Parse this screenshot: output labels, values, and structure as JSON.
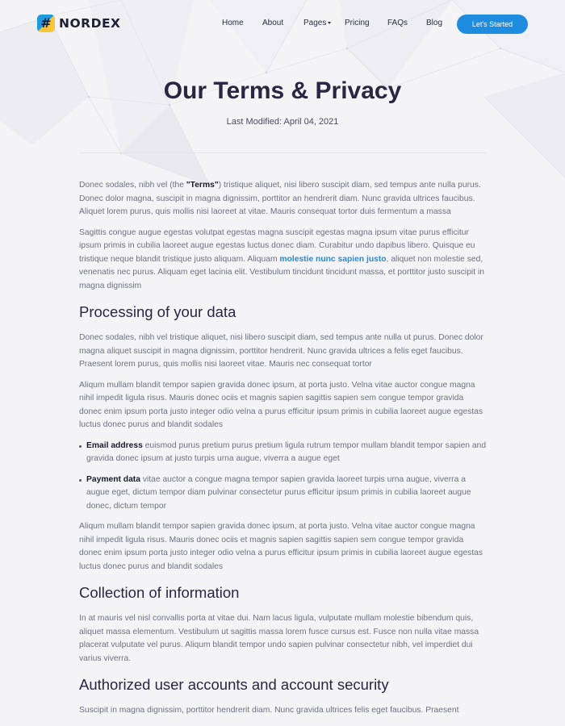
{
  "brand": {
    "logo_glyph": "#",
    "name": "NORDEX",
    "primary": "#1e8de0",
    "accent": "#f7c63b"
  },
  "nav": {
    "items": [
      "Home",
      "About",
      "Pages",
      "Pricing",
      "FAQs",
      "Blog"
    ],
    "cta": "Let's Started"
  },
  "page": {
    "title": "Our Terms & Privacy",
    "modified": "Last Modified: April 04, 2021"
  },
  "intro": {
    "p1_a": "Donec sodales, nibh vel (the ",
    "p1_b": "\"Terms\"",
    "p1_c": ") tristique aliquet, nisi libero suscipit diam, sed tempus ante nulla purus. Donec dolor magna, suscipit in magna dignissim, porttitor an hendrerit diam. Nunc gravida ultrices faucibus. Aliquet lorem purus, quis mollis nisi laoreet at vitae. Mauris consequat tortor duis fermentum a massa",
    "p2_a": "Sagittis congue augue egestas volutpat egestas magna suscipit egestas magna ipsum vitae purus efficitur ipsum primis in cubilia laoreet augue egestas luctus donec diam. Curabitur undo dapibus libero. Quisque eu tristique neque blandit tristique justo aliquam. Aliquam ",
    "p2_link": "molestie nunc sapien justo",
    "p2_c": ", aliquet non molestie sed, venenatis nec purus. Aliquam eget lacinia elit. Vestibulum tincidunt tincidunt massa, et porttitor justo suscipit in magna dignissim"
  },
  "processing": {
    "heading": "Processing of your data",
    "p1": "Donec sodales, nibh vel tristique aliquet, nisi libero suscipit diam, sed tempus ante nulla ut purus. Donec dolor magna aliquet suscipit in magna dignissim, porttitor hendrerit. Nunc gravida ultrices a felis eget faucibus. Praesent lorem purus, quis mollis nisi laoreet vitae. Mauris nec consequat tortor",
    "p2": "Aliqum mullam blandit tempor sapien gravida donec ipsum, at porta justo. Velna vitae auctor congue magna nihil impedit ligula risus. Mauris donec ociis et magnis sapien sagittis sapien sem congue tempor gravida donec enim ipsum porta justo integer odio velna a purus efficitur ipsum primis in cubilia laoreet augue egestas luctus donec purus and blandit sodales",
    "bullet1_label": "Email address",
    "bullet1_text": " euismod purus pretium purus pretium ligula rutrum tempor mullam blandit tempor sapien and gravida donec ipsum at justo turpis urna augue, viverra a augue eget",
    "bullet2_label": "Payment data",
    "bullet2_text": " vitae auctor a congue magna tempor sapien gravida laoreet turpis urna augue, viverra a augue eget, dictum tempor diam pulvinar consectetur purus efficitur ipsum primis in cubilia laoreet augue donec, dictum tempor",
    "p3": "Aliqum mullam blandit tempor sapien gravida donec ipsum, at porta justo. Velna vitae auctor congue magna nihil impedit ligula risus. Mauris donec ociis et magnis sapien sagittis sapien sem congue tempor gravida donec enim ipsum porta justo integer odio velna a purus efficitur ipsum primis in cubilia laoreet augue egestas luctus donec purus and blandit sodales"
  },
  "collection": {
    "heading": "Collection of information",
    "p1": "In at mauris vel nisl convallis porta at vitae dui. Nam lacus ligula, vulputate mullam molestie bibendum quis, aliquet massa elementum. Vestibulum ut sagittis massa lorem fusce cursus est. Fusce non nulla vitae massa placerat vulputate vel purus. Aliqum blandit tempor undo sapien pulvinar consectetur nibh, vel imperdiet dui varius viverra."
  },
  "accounts": {
    "heading": "Authorized user accounts and account security",
    "p1": "Suscipit in magna dignissim, porttitor hendrerit diam. Nunc gravida ultrices felis eget faucibus. Praesent"
  }
}
